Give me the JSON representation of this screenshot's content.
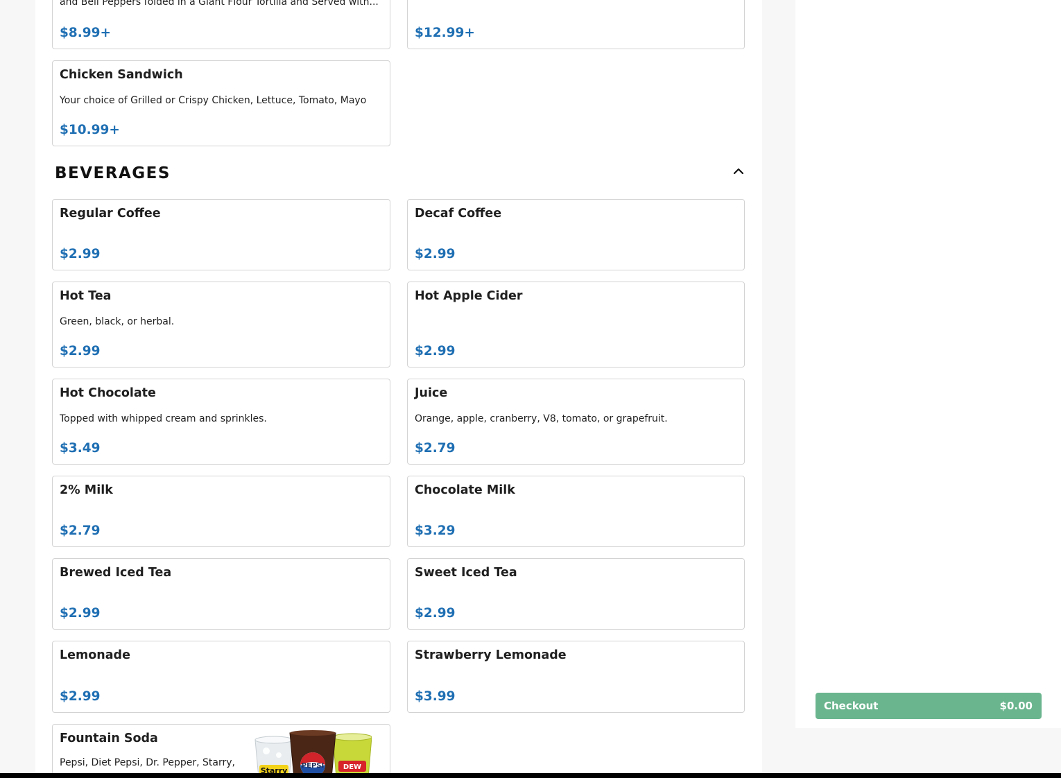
{
  "menu": {
    "top_items": [
      {
        "name": "",
        "description": "and Bell Peppers folded in a Giant Flour Tortilla and Served with...",
        "price": "$8.99+"
      },
      {
        "name": "",
        "description": "",
        "price": "$12.99+"
      },
      {
        "name": "Chicken Sandwich",
        "description": "Your choice of Grilled or Crispy Chicken, Lettuce, Tomato, Mayo",
        "price": "$10.99+"
      }
    ],
    "beverages": {
      "title": "BEVERAGES",
      "collapse_icon": "chevron-up-icon",
      "items": [
        {
          "name": "Regular Coffee",
          "description": "",
          "price": "$2.99"
        },
        {
          "name": "Decaf Coffee",
          "description": "",
          "price": "$2.99"
        },
        {
          "name": "Hot Tea",
          "description": "Green, black, or herbal.",
          "price": "$2.99"
        },
        {
          "name": "Hot Apple Cider",
          "description": "",
          "price": "$2.99"
        },
        {
          "name": "Hot Chocolate",
          "description": "Topped with whipped cream and sprinkles.",
          "price": "$3.49"
        },
        {
          "name": "Juice",
          "description": "Orange, apple, cranberry, V8, tomato, or grapefruit.",
          "price": "$2.79"
        },
        {
          "name": "2% Milk",
          "description": "",
          "price": "$2.79"
        },
        {
          "name": "Chocolate Milk",
          "description": "",
          "price": "$3.29"
        },
        {
          "name": "Brewed Iced Tea",
          "description": "",
          "price": "$2.99"
        },
        {
          "name": "Sweet Iced Tea",
          "description": "",
          "price": "$2.99"
        },
        {
          "name": "Lemonade",
          "description": "",
          "price": "$2.99"
        },
        {
          "name": "Strawberry Lemonade",
          "description": "",
          "price": "$3.99"
        },
        {
          "name": "Fountain Soda",
          "description": "Pepsi, Diet Pepsi, Dr. Pepper, Starry, or Mountain Dew",
          "price": "",
          "image_labels": {
            "cup1": "Starry",
            "cup2": "PEPSI",
            "cup3": "DEW"
          }
        }
      ]
    }
  },
  "cart": {
    "checkout_label": "Checkout",
    "total": "$0.00"
  },
  "colors": {
    "price": "#1f6fb3",
    "checkout": "#6ab58e",
    "border": "#d3d3d3"
  }
}
